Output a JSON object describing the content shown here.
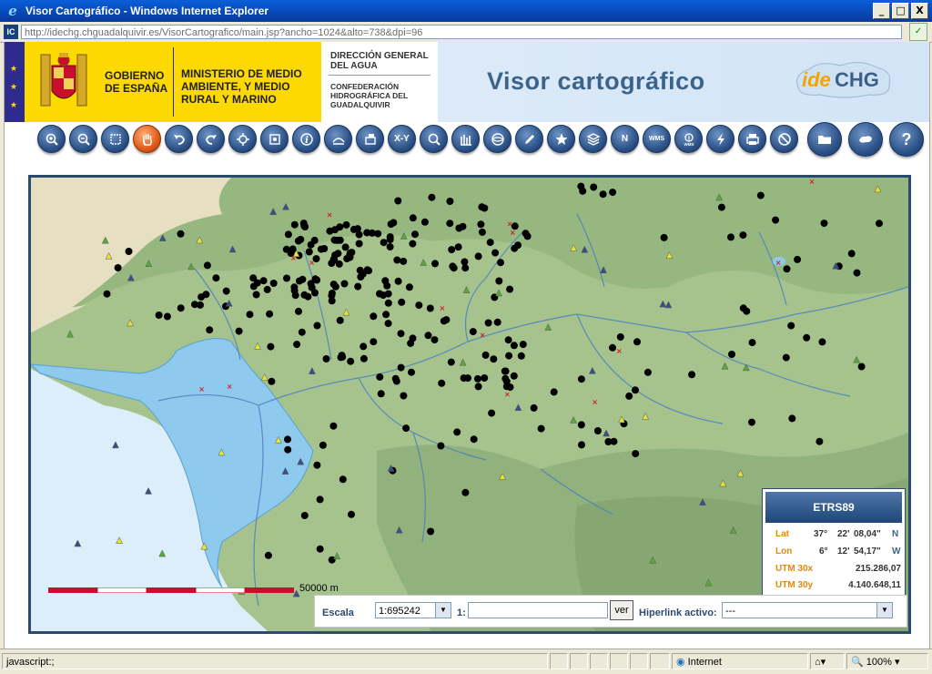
{
  "window": {
    "title": "Visor Cartográfico - Windows Internet Explorer",
    "buttons": [
      "_",
      "□",
      "X"
    ]
  },
  "address": {
    "icon_text": "IC",
    "url": "http://idechg.chguadalquivir.es/VisorCartografico/main.jsp?ancho=1024&alto=738&dpi=96"
  },
  "header": {
    "gobierno": "GOBIERNO DE ESPAÑA",
    "ministerio": "MINISTERIO DE MEDIO AMBIENTE, Y MEDIO RURAL Y MARINO",
    "direccion": "DIRECCIÓN GENERAL DEL AGUA",
    "confederacion": "CONFEDERACIÓN HIDROGRÁFICA DEL GUADALQUIVIR",
    "title": "Visor cartográfico",
    "logo_text": "ideCHG"
  },
  "toolbar": {
    "tools": [
      {
        "name": "zoom-in-tool",
        "label": ""
      },
      {
        "name": "zoom-out-tool",
        "label": ""
      },
      {
        "name": "zoom-box-tool",
        "label": ""
      },
      {
        "name": "pan-tool",
        "label": ""
      },
      {
        "name": "back-tool",
        "label": ""
      },
      {
        "name": "forward-tool",
        "label": ""
      },
      {
        "name": "center-tool",
        "label": ""
      },
      {
        "name": "full-extent-tool",
        "label": ""
      },
      {
        "name": "info-tool",
        "label": ""
      },
      {
        "name": "measure-tool",
        "label": ""
      },
      {
        "name": "area-tool",
        "label": ""
      },
      {
        "name": "xy-tool",
        "label": "X-Y"
      },
      {
        "name": "search-tool",
        "label": ""
      },
      {
        "name": "chart-tool",
        "label": ""
      },
      {
        "name": "layers-tool",
        "label": ""
      },
      {
        "name": "draw-tool",
        "label": ""
      },
      {
        "name": "favorites-tool",
        "label": ""
      },
      {
        "name": "legend-tool",
        "label": ""
      },
      {
        "name": "north-tool",
        "label": "N"
      },
      {
        "name": "wms-tool",
        "label": "WMS"
      },
      {
        "name": "wms-info-tool",
        "label": ""
      },
      {
        "name": "lightning-tool",
        "label": ""
      },
      {
        "name": "print-tool",
        "label": ""
      },
      {
        "name": "clear-tool",
        "label": ""
      },
      {
        "name": "folder-tool",
        "label": ""
      },
      {
        "name": "overview-tool",
        "label": ""
      },
      {
        "name": "help-tool",
        "label": "?"
      }
    ]
  },
  "map": {
    "scale_label": "50000 m"
  },
  "coords": {
    "system": "ETRS89",
    "lat_label": "Lat",
    "lat_deg": "37°",
    "lat_min": "22'",
    "lat_sec": "08,04\"",
    "lat_dir": "N",
    "lon_label": "Lon",
    "lon_deg": "6°",
    "lon_min": "12'",
    "lon_sec": "54,17\"",
    "lon_dir": "W",
    "utmx_label": "UTM 30x",
    "utmx": "215.286,07",
    "utmy_label": "UTM 30y",
    "utmy": "4.140.648,11"
  },
  "bottom": {
    "escala_label": "Escala",
    "escala_value": "1:695242",
    "one_label": "1:",
    "ver_label": "ver",
    "hiperlink_label": "Hiperlink activo:",
    "hiperlink_value": "---"
  },
  "status": {
    "text": "javascript:;",
    "zone": "Internet",
    "zoom": "100%"
  },
  "colors": {
    "accent": "#3b648d",
    "map_frame": "#2c4a70",
    "coord_label": "#e08a0c"
  }
}
